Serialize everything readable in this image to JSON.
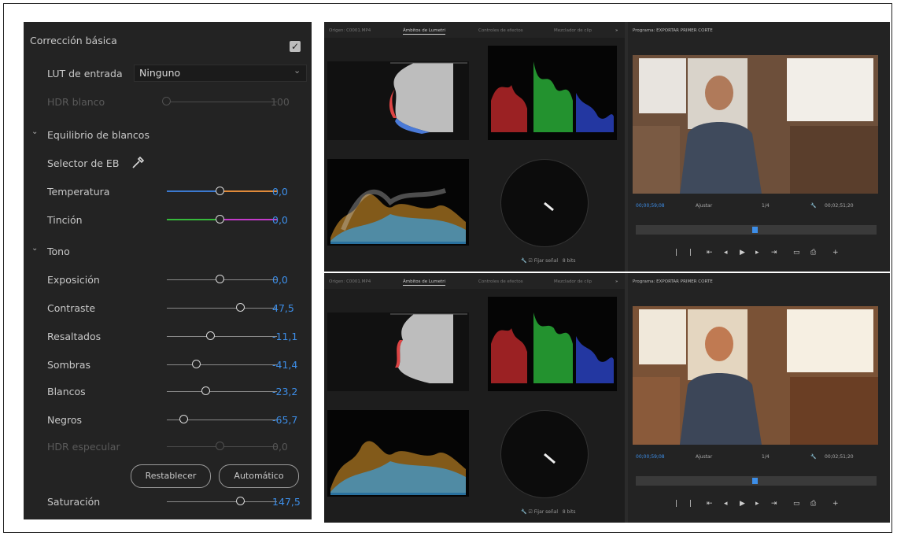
{
  "lumetri": {
    "basic_title": "Corrección básica",
    "lut_label": "LUT de entrada",
    "lut_value": "Ninguno",
    "hdr_white_label": "HDR blanco",
    "hdr_white_value": "100",
    "wb_section": "Equilibrio de blancos",
    "wb_selector_label": "Selector de EB",
    "temperature_label": "Temperatura",
    "temperature_value": "0,0",
    "tint_label": "Tinción",
    "tint_value": "0,0",
    "tone_section": "Tono",
    "exposure_label": "Exposición",
    "exposure_value": "0,0",
    "contrast_label": "Contraste",
    "contrast_value": "47,5",
    "highlights_label": "Resaltados",
    "highlights_value": "-11,1",
    "shadows_label": "Sombras",
    "shadows_value": "-41,4",
    "whites_label": "Blancos",
    "whites_value": "-23,2",
    "blacks_label": "Negros",
    "blacks_value": "-65,7",
    "hdr_specular_label": "HDR especular",
    "hdr_specular_value": "0,0",
    "reset_button": "Restablecer",
    "auto_button": "Automático",
    "saturation_label": "Saturación",
    "saturation_value": "147,5",
    "accent_color": "#3d8ee8"
  },
  "panels": [
    {
      "tabs": [
        "Origen: C0001.MP4",
        "Ámbitos de Lumetri",
        "Controles de efectos",
        "Mezclador de clip"
      ],
      "program_title": "Programa: EXPORTAR PRIMER CORTE",
      "timecode_in": "00;00;59;08",
      "fit_label": "Ajustar",
      "quality_label": "1/4",
      "timecode_out": "00;02;51;20",
      "scope_footer_check": "Fijar señal",
      "scope_footer_bits": "8 bits"
    },
    {
      "tabs": [
        "Origen: C0001.MP4",
        "Ámbitos de Lumetri",
        "Controles de efectos",
        "Mezclador de clip"
      ],
      "program_title": "Programa: EXPORTAR PRIMER CORTE",
      "timecode_in": "00;00;59;08",
      "fit_label": "Ajustar",
      "quality_label": "1/4",
      "timecode_out": "00;02;51;20",
      "scope_footer_check": "Fijar señal",
      "scope_footer_bits": "8 bits"
    }
  ]
}
